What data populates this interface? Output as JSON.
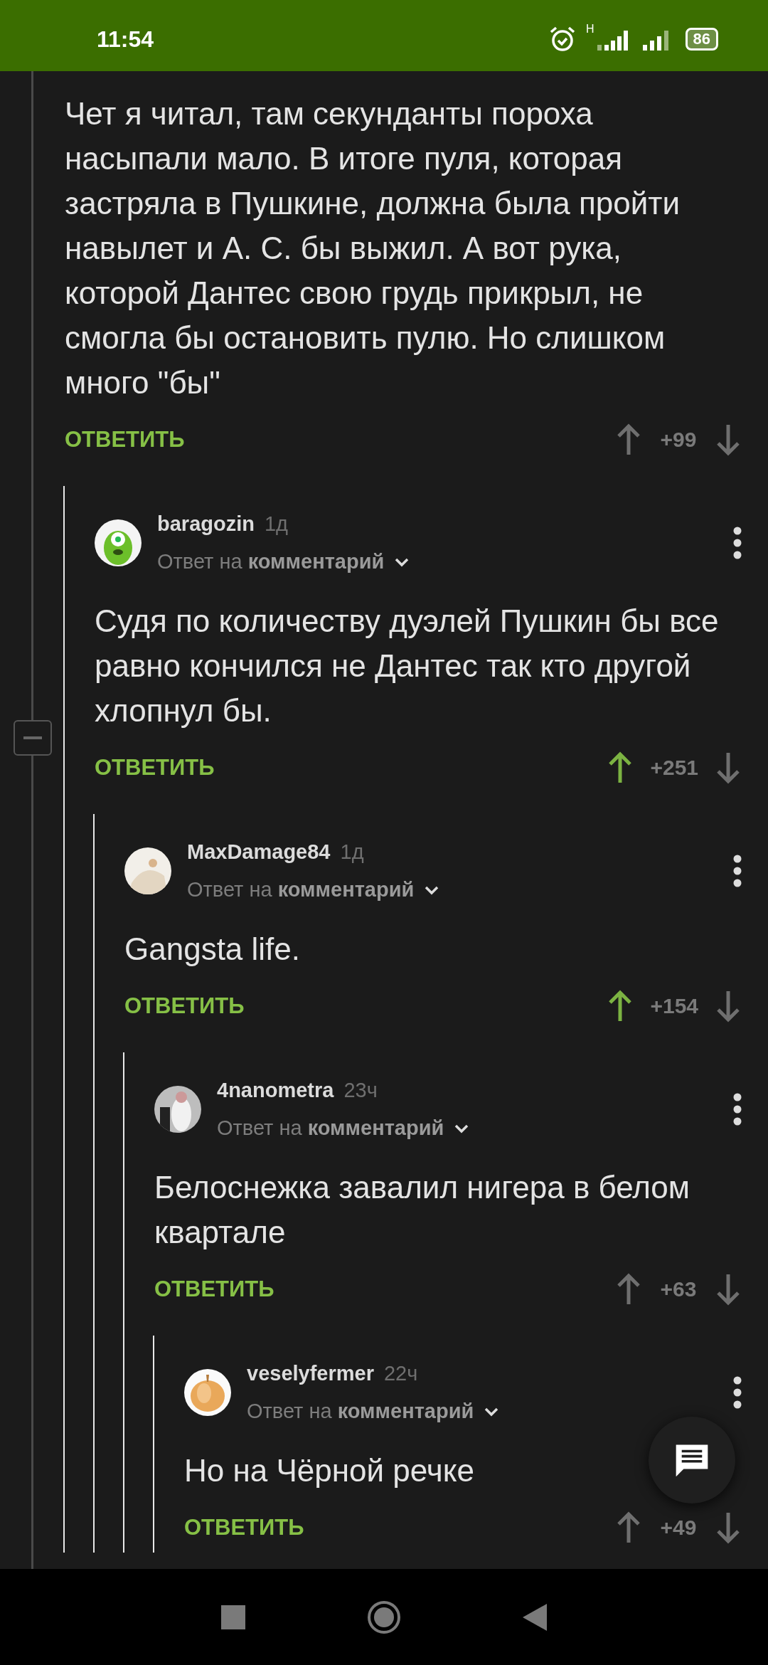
{
  "status_bar": {
    "time": "11:54",
    "network": "H",
    "battery": "86"
  },
  "thread": {
    "body": "Чет я читал, там секунданты пороха насыпали мало. В итоге пуля, которая застряла в Пушкине, должна была пройти навылет и А. С. бы выжил. А вот рука, которой Дантес свою грудь прикрыл, не смогла бы остановить пулю. Но слишком много \"бы\"",
    "reply_label": "ОТВЕТИТЬ",
    "votes": "+99",
    "upvoted": false,
    "collapsed": false,
    "replies": [
      {
        "author": "baragozin",
        "time": "1д",
        "reply_to": "Ответ на **комментарий**",
        "body": "Судя по количеству дуэлей Пушкин бы все равно кончился не Дантес так кто другой хлопнул бы.",
        "reply_label": "ОТВЕТИТЬ",
        "votes": "+251",
        "upvoted": true,
        "replies": [
          {
            "author": "MaxDamage84",
            "time": "1д",
            "reply_to": "Ответ на **комментарий**",
            "body": "Gangsta life.",
            "reply_label": "ОТВЕТИТЬ",
            "votes": "+154",
            "upvoted": true,
            "replies": [
              {
                "author": "4nanometra",
                "time": "23ч",
                "reply_to": "Ответ на **комментарий**",
                "body": "Белоснежка завалил нигера в белом квартале",
                "reply_label": "ОТВЕТИТЬ",
                "votes": "+63",
                "upvoted": false,
                "replies": [
                  {
                    "author": "veselyfermer",
                    "time": "22ч",
                    "reply_to": "Ответ на **комментарий**",
                    "body": "Но на Чёрной речке",
                    "reply_label": "ОТВЕТИТЬ",
                    "votes": "+49",
                    "upvoted": false
                  }
                ]
              }
            ]
          }
        ]
      }
    ]
  }
}
